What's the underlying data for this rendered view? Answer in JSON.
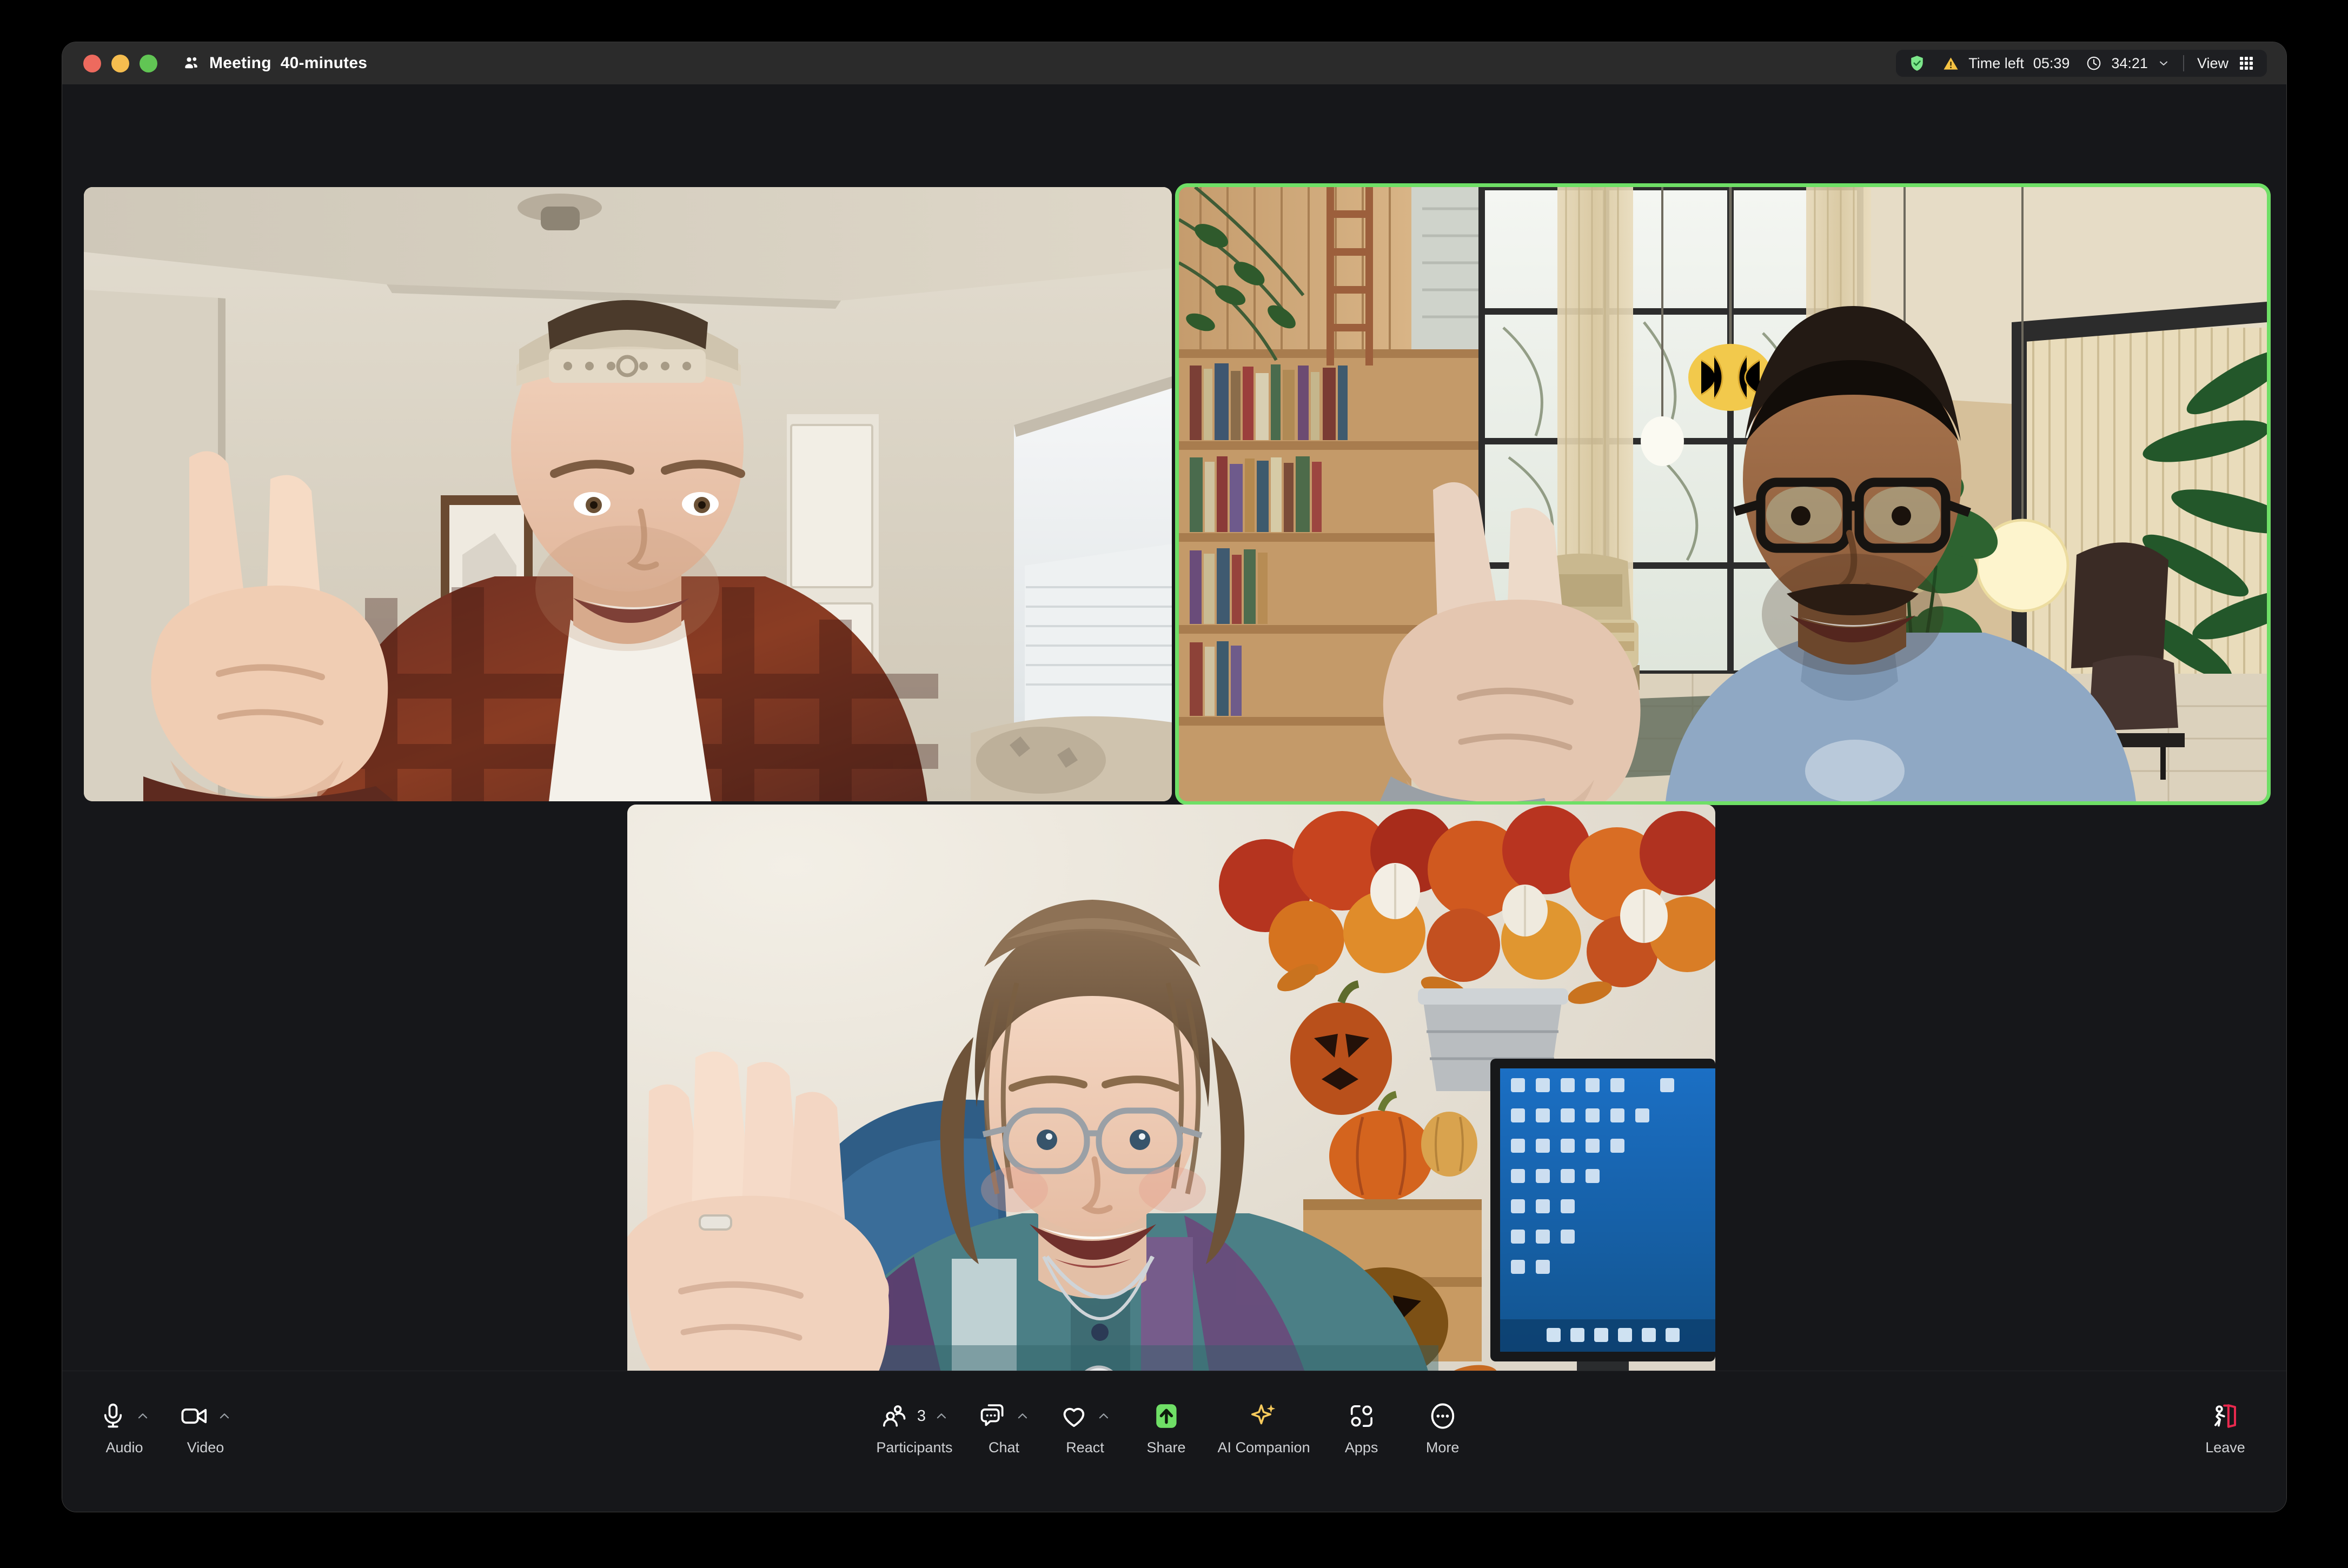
{
  "window": {
    "titlebar": {
      "traffic_lights": [
        {
          "name": "close",
          "color": "#ed6a5e"
        },
        {
          "name": "minimize",
          "color": "#f5bd4f"
        },
        {
          "name": "zoom",
          "color": "#61c554"
        }
      ],
      "meeting_icon": "participants-group-icon",
      "title": "Meeting",
      "subtitle": "40-minutes"
    },
    "status_bar": {
      "encryption_icon": "shield-check-icon",
      "encryption_color": "#7ce68a",
      "warning_icon": "warning-triangle-icon",
      "warning_color": "#f5c242",
      "time_left_label": "Time left",
      "time_left_value": "05:39",
      "clock_icon": "clock-icon",
      "elapsed_value": "34:21",
      "elapsed_caret_icon": "chevron-down-icon",
      "view_label": "View",
      "view_icon": "grid-view-icon"
    }
  },
  "gallery": {
    "active_speaker_color": "#6fdf66",
    "tiles": [
      {
        "id": "tile-1",
        "name": "participant-tile-top-left",
        "active_speaker": false,
        "scene": "man-in-backwards-cap-making-peace-sign-in-bright-room"
      },
      {
        "id": "tile-2",
        "name": "participant-tile-top-right",
        "active_speaker": true,
        "scene": "man-with-glasses-making-peace-sign-eames-house-virtual-background"
      },
      {
        "id": "tile-3",
        "name": "participant-tile-bottom-center",
        "active_speaker": false,
        "scene": "woman-with-glasses-waving-home-office-with-autumn-decor"
      }
    ]
  },
  "toolbar": {
    "left": [
      {
        "id": "audio",
        "label": "Audio",
        "icon": "microphone-icon",
        "has_caret": true
      },
      {
        "id": "video",
        "label": "Video",
        "icon": "camera-icon",
        "has_caret": true
      }
    ],
    "center": [
      {
        "id": "participants",
        "label": "Participants",
        "icon": "participants-icon",
        "badge": "3",
        "has_caret": true
      },
      {
        "id": "chat",
        "label": "Chat",
        "icon": "chat-bubble-icon",
        "has_caret": true
      },
      {
        "id": "react",
        "label": "React",
        "icon": "heart-icon",
        "has_caret": true
      },
      {
        "id": "share",
        "label": "Share",
        "icon": "share-screen-icon",
        "has_caret": false,
        "accent": "#6fdf66"
      },
      {
        "id": "ai-companion",
        "label": "AI Companion",
        "icon": "sparkle-icon",
        "has_caret": false,
        "accent": "#f5c95c"
      },
      {
        "id": "apps",
        "label": "Apps",
        "icon": "apps-icon",
        "has_caret": false
      },
      {
        "id": "more",
        "label": "More",
        "icon": "more-ellipsis-icon",
        "has_caret": false
      }
    ],
    "right": [
      {
        "id": "leave",
        "label": "Leave",
        "icon": "leave-door-icon",
        "accent": "#e8294e"
      }
    ]
  }
}
